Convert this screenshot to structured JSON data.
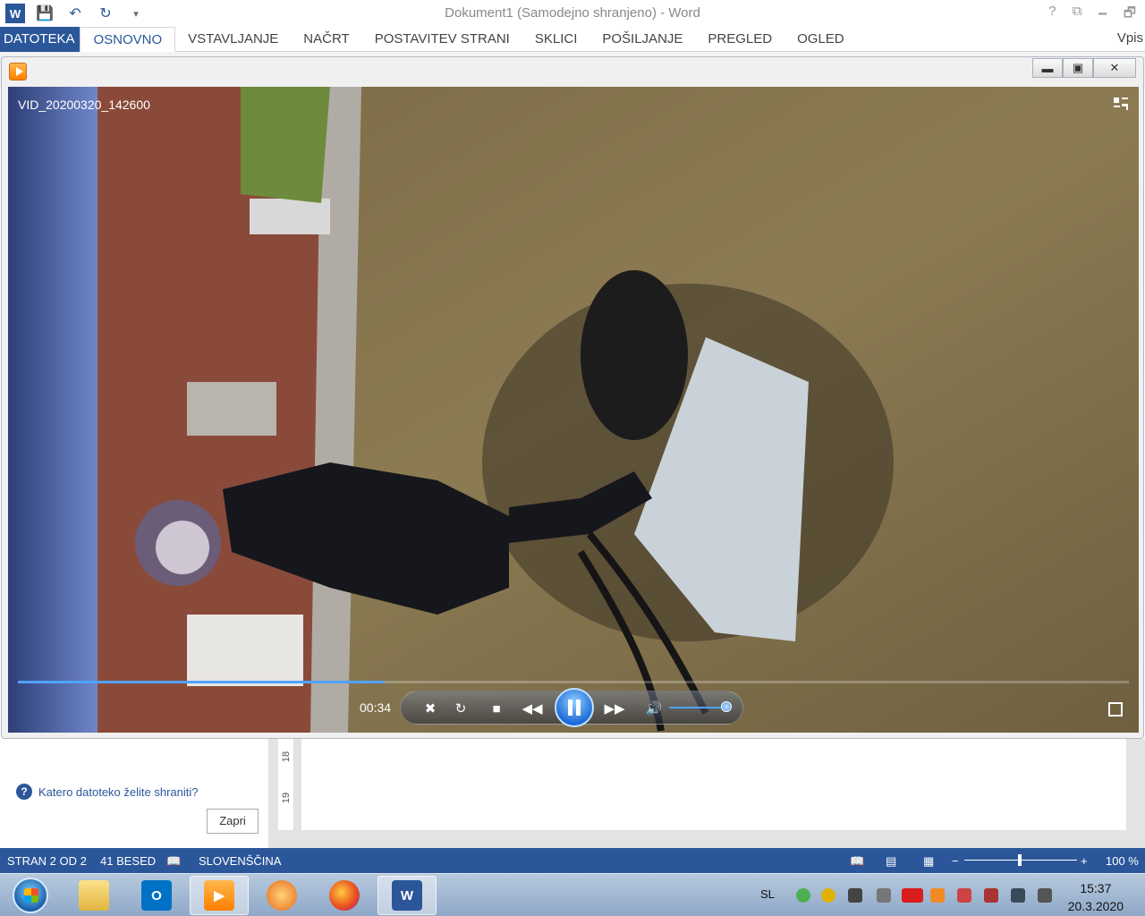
{
  "word": {
    "title": "Dokument1 (Samodejno shranjeno) - Word",
    "logo_letter": "W",
    "window_controls": [
      "?",
      "⧉",
      "🗕",
      "🗗"
    ],
    "tabs": [
      {
        "label": "DATOTEKA"
      },
      {
        "label": "OSNOVNO"
      },
      {
        "label": "VSTAVLJANJE"
      },
      {
        "label": "NAČRT"
      },
      {
        "label": "POSTAVITEV STRANI"
      },
      {
        "label": "SKLICI"
      },
      {
        "label": "POŠILJANJE"
      },
      {
        "label": "PREGLED"
      },
      {
        "label": "OGLED"
      }
    ],
    "signin": "Vpis"
  },
  "player": {
    "video_title": "VID_20200320_142600",
    "time": "00:34",
    "progress_fraction": 0.33,
    "volume_fraction": 0.95
  },
  "pane": {
    "question": "Katero datoteko želite shraniti?",
    "close_label": "Zapri"
  },
  "ruler": {
    "nums": [
      "18",
      "19"
    ]
  },
  "status": {
    "page": "STRAN 2 OD 2",
    "words": "41 BESED",
    "language": "SLOVENŠČINA",
    "zoom": "100 %"
  },
  "tray": {
    "lang": "SL",
    "time": "15:37",
    "date": "20.3.2020"
  },
  "colors": {
    "word_blue": "#2b579a",
    "accent": "#4fa3ff"
  }
}
